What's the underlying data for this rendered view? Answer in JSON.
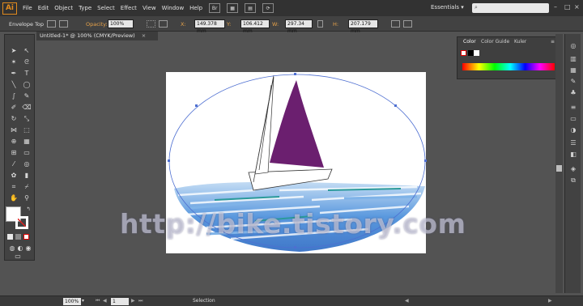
{
  "menubar": {
    "app_logo": "Ai",
    "items": [
      "File",
      "Edit",
      "Object",
      "Type",
      "Select",
      "Effect",
      "View",
      "Window",
      "Help"
    ],
    "br_icon": "Br",
    "workspace": "Essentials",
    "workspace_arrow": "▾",
    "search_placeholder": ""
  },
  "controlbar": {
    "mode_label": "Envelope Top",
    "opacity_label": "Opacity:",
    "opacity_value": "100%",
    "x_label": "X:",
    "x_value": "149.378 mm",
    "y_label": "Y:",
    "y_value": "106.412 mm",
    "w_label": "W:",
    "w_value": "297.34 mm",
    "h_label": "H:",
    "h_value": "207.179 mm"
  },
  "document": {
    "tab_title": "Untitled-1* @ 100% (CMYK/Preview)",
    "close": "×"
  },
  "colorpanel": {
    "tabs": [
      "Color",
      "Color Guide",
      "Kuler"
    ],
    "menu_icon": "≡",
    "spectrum_colors": [
      "#ff0000",
      "#ffff00",
      "#00ff00",
      "#00ffff",
      "#0000ff",
      "#ff00ff"
    ]
  },
  "artwork": {
    "sail_color": "#6b1f6f",
    "ellipse_color": "#4e6fd1",
    "water_colors": [
      "#1e5fbf",
      "#3c86d8",
      "#7fb3e8",
      "#b9d6f2",
      "#2b9a9a"
    ]
  },
  "statusbar": {
    "zoom": "100%",
    "page": "1",
    "tool": "Selection"
  },
  "watermark": "http://bike.tistory.com"
}
